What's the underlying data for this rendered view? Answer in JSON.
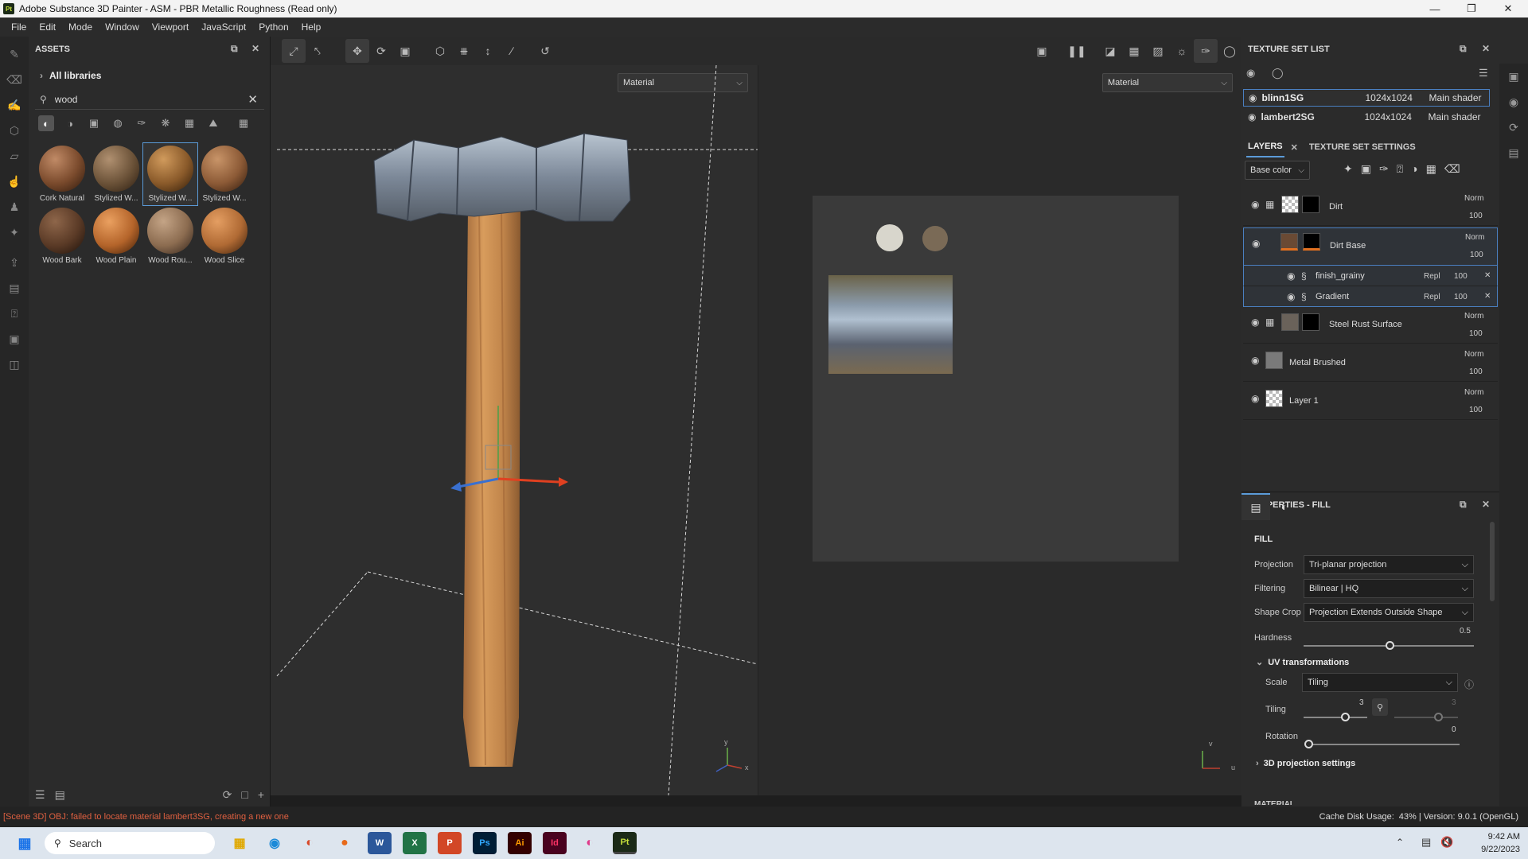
{
  "window": {
    "title": "Adobe Substance 3D Painter - ASM - PBR Metallic Roughness (Read only)",
    "logo": "Pt"
  },
  "menu": [
    "File",
    "Edit",
    "Mode",
    "Window",
    "Viewport",
    "JavaScript",
    "Python",
    "Help"
  ],
  "assets": {
    "title": "ASSETS",
    "library": "All libraries",
    "search_value": "wood",
    "items": [
      {
        "label": "Cork Natural",
        "color": "#7a4a2c"
      },
      {
        "label": "Stylized W...",
        "color": "#6b5238"
      },
      {
        "label": "Stylized W...",
        "color": "#8a5a2a",
        "selected": true
      },
      {
        "label": "Stylized W...",
        "color": "#8c5a36"
      },
      {
        "label": "Wood Bark",
        "color": "#5a3a26"
      },
      {
        "label": "Wood Plain",
        "color": "#b4642a"
      },
      {
        "label": "Wood Rou...",
        "color": "#8c6c50"
      },
      {
        "label": "Wood Slice",
        "color": "#b06a34"
      }
    ]
  },
  "viewport": {
    "left_mode": "Material",
    "right_mode": "Material",
    "axis_labels": {
      "x": "x",
      "y": "y",
      "u": "u",
      "v": "v"
    }
  },
  "texture_sets": {
    "title": "TEXTURE SET LIST",
    "rows": [
      {
        "name": "blinn1SG",
        "size": "1024x1024",
        "shader": "Main shader",
        "selected": true
      },
      {
        "name": "lambert2SG",
        "size": "1024x1024",
        "shader": "Main shader",
        "selected": false
      }
    ]
  },
  "layers": {
    "tab_layers": "LAYERS",
    "tab_settings": "TEXTURE SET SETTINGS",
    "channel": "Base color",
    "items": [
      {
        "name": "Dirt",
        "blend": "Norm",
        "opacity": "100"
      },
      {
        "name": "Dirt Base",
        "blend": "Norm",
        "opacity": "100"
      },
      {
        "name": "finish_grainy",
        "blend": "Repl",
        "opacity": "100"
      },
      {
        "name": "Gradient",
        "blend": "Repl",
        "opacity": "100"
      },
      {
        "name": "Steel Rust Surface",
        "blend": "Norm",
        "opacity": "100"
      },
      {
        "name": "Metal Brushed",
        "blend": "Norm",
        "opacity": "100"
      },
      {
        "name": "Layer 1",
        "blend": "Norm",
        "opacity": "100"
      }
    ]
  },
  "properties": {
    "title": "PROPERTIES - FILL",
    "section": "FILL",
    "projection_label": "Projection",
    "projection": "Tri-planar projection",
    "filtering_label": "Filtering",
    "filtering": "Bilinear | HQ",
    "shapecrop_label": "Shape Crop",
    "shapecrop": "Projection Extends Outside Shape",
    "hardness_label": "Hardness",
    "hardness": "0.5",
    "uv_title": "UV transformations",
    "scale_label": "Scale",
    "scale": "Tiling",
    "tiling_label": "Tiling",
    "tiling_u": "3",
    "tiling_v": "3",
    "rotation_label": "Rotation",
    "rotation": "0",
    "proj3d": "3D projection settings",
    "material_cut": "MATERIAL"
  },
  "status": {
    "error": "[Scene 3D] OBJ: failed to locate material lambert3SG, creating a new one",
    "cache_label": "Cache Disk Usage:",
    "cache_info": "43% | Version: 9.0.1 (OpenGL)"
  },
  "taskbar": {
    "search": "Search",
    "time": "9:42 AM",
    "date": "9/22/2023",
    "apps": [
      "W",
      "X",
      "P",
      "Ps",
      "Ai",
      "Id",
      "Pt"
    ]
  }
}
